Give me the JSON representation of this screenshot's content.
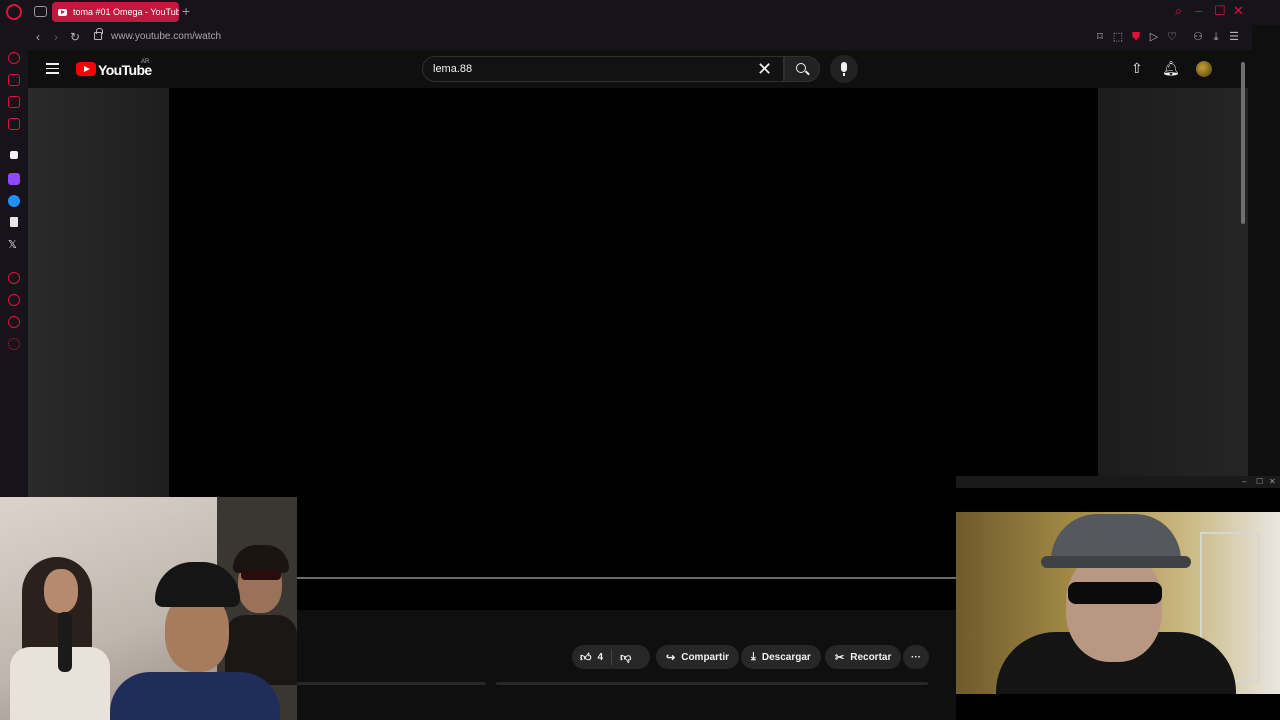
{
  "browser": {
    "tab_title": "toma #01 Omega - YouTub",
    "new_tab": "+",
    "url": "www.youtube.com/watch",
    "window_controls": [
      "search-icon",
      "minimize-icon",
      "maximize-icon",
      "close-icon"
    ]
  },
  "youtube": {
    "logo_text": "YouTube",
    "country": "AR",
    "search_value": "lema.88",
    "header_icons": [
      "upload-icon",
      "bell-icon",
      "avatar"
    ]
  },
  "actions": {
    "like_count": "4",
    "share": "Compartir",
    "download": "Descargar",
    "clip": "Recortar",
    "more": "···"
  },
  "colors": {
    "accent": "#e0103a",
    "yt_red": "#ff0000",
    "background": "#0f0f0f"
  }
}
